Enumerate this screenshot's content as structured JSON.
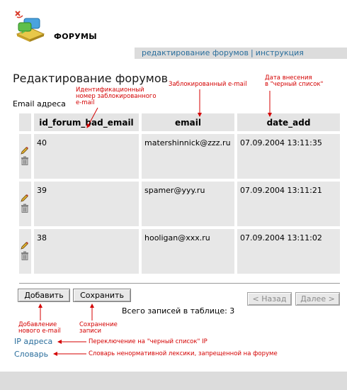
{
  "header": {
    "app_title": "ФОРУМЫ"
  },
  "nav": {
    "links": [
      "редактирование форумов",
      "инструкция"
    ],
    "separator": "|"
  },
  "page_title": "Редактирование форумов",
  "section_title": "Email адреса",
  "table": {
    "columns": [
      "id_forum_bad_email",
      "email",
      "date_add"
    ],
    "rows": [
      {
        "id": "40",
        "email": "matershinnick@zzz.ru",
        "date": "07.09.2004 13:11:35"
      },
      {
        "id": "39",
        "email": "spamer@yyy.ru",
        "date": "07.09.2004 13:11:21"
      },
      {
        "id": "38",
        "email": "hooligan@xxx.ru",
        "date": "07.09.2004 13:11:02"
      }
    ]
  },
  "buttons": {
    "add": "Добавить",
    "save": "Сохранить",
    "prev": "< Назад",
    "next": "Далее >"
  },
  "total_text": "Всего записей в таблице: 3",
  "links": {
    "ip": "IP адреса",
    "dictionary": "Словарь"
  },
  "annotations": {
    "id_line1": "Идентификационный",
    "id_line2": "номер заблокированного",
    "id_line3": "e-mail",
    "email": "Заблокированный e-mail",
    "date_line1": "Дата внесения",
    "date_line2": "в \"черный список\"",
    "add_line1": "Добавление",
    "add_line2": "нового e-mail",
    "save_line1": "Сохранение",
    "save_line2": "записи",
    "ip": "Переключение на \"черный список\" IP",
    "dictionary": "Словарь ненормативной лексики, запрещенной на форуме"
  },
  "colors": {
    "link": "#2a6e9c",
    "annotation": "#d40000",
    "panel": "#e7e7e7"
  }
}
